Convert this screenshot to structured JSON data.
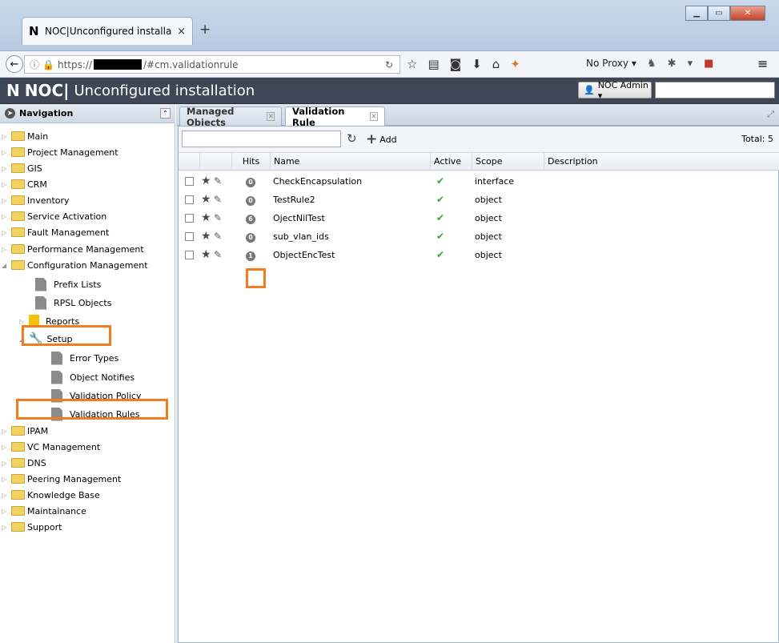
{
  "browser": {
    "tab_title": "NOC|Unconfigured installa...",
    "tab_close": "×",
    "new_tab": "+",
    "url_prefix": "https://",
    "url_suffix": "/#cm.validationrule",
    "proxy_label": "No Proxy ▾"
  },
  "app": {
    "brand_short": "NOC|",
    "title": "Unconfigured installation",
    "user": "NOC Admin ▾"
  },
  "sidebar": {
    "header": "Navigation",
    "items": [
      {
        "label": "Main",
        "type": "folder",
        "level": 0,
        "state": "collapsed"
      },
      {
        "label": "Project Management",
        "type": "folder",
        "level": 0,
        "state": "collapsed"
      },
      {
        "label": "GIS",
        "type": "folder",
        "level": 0,
        "state": "collapsed"
      },
      {
        "label": "CRM",
        "type": "folder",
        "level": 0,
        "state": "collapsed"
      },
      {
        "label": "Inventory",
        "type": "folder",
        "level": 0,
        "state": "collapsed"
      },
      {
        "label": "Service Activation",
        "type": "folder",
        "level": 0,
        "state": "collapsed"
      },
      {
        "label": "Fault Management",
        "type": "folder",
        "level": 0,
        "state": "collapsed"
      },
      {
        "label": "Performance Management",
        "type": "folder",
        "level": 0,
        "state": "collapsed"
      },
      {
        "label": "Configuration Management",
        "type": "folder",
        "level": 0,
        "state": "expanded"
      },
      {
        "label": "Prefix Lists",
        "type": "doc",
        "level": 1
      },
      {
        "label": "RPSL Objects",
        "type": "doc",
        "level": 1
      },
      {
        "label": "Reports",
        "type": "report",
        "level": 1,
        "state": "collapsed"
      },
      {
        "label": "Setup",
        "type": "wrench",
        "level": 1,
        "state": "expanded"
      },
      {
        "label": "Error Types",
        "type": "doc",
        "level": 2
      },
      {
        "label": "Object Notifies",
        "type": "doc",
        "level": 2
      },
      {
        "label": "Validation Policy",
        "type": "doc",
        "level": 2
      },
      {
        "label": "Validation Rules",
        "type": "doc",
        "level": 2
      },
      {
        "label": "IPAM",
        "type": "folder",
        "level": 0,
        "state": "collapsed"
      },
      {
        "label": "VC Management",
        "type": "folder",
        "level": 0,
        "state": "collapsed"
      },
      {
        "label": "DNS",
        "type": "folder",
        "level": 0,
        "state": "collapsed"
      },
      {
        "label": "Peering Management",
        "type": "folder",
        "level": 0,
        "state": "collapsed"
      },
      {
        "label": "Knowledge Base",
        "type": "folder",
        "level": 0,
        "state": "collapsed"
      },
      {
        "label": "Maintainance",
        "type": "folder",
        "level": 0,
        "state": "collapsed"
      },
      {
        "label": "Support",
        "type": "folder",
        "level": 0,
        "state": "collapsed"
      }
    ]
  },
  "tabs": [
    {
      "label": "Managed Objects",
      "active": false
    },
    {
      "label": "Validation Rule",
      "active": true
    }
  ],
  "toolbar": {
    "add_label": "Add",
    "total": "Total: 5"
  },
  "grid": {
    "columns": [
      "Hits",
      "Name",
      "Active",
      "Scope",
      "Description"
    ],
    "rows": [
      {
        "hits": "0",
        "name": "CheckEncapsulation",
        "active": "✔",
        "scope": "interface",
        "description": ""
      },
      {
        "hits": "0",
        "name": "TestRule2",
        "active": "✔",
        "scope": "object",
        "description": ""
      },
      {
        "hits": "6",
        "name": "OjectNilTest",
        "active": "✔",
        "scope": "object",
        "description": ""
      },
      {
        "hits": "0",
        "name": "sub_vlan_ids",
        "active": "✔",
        "scope": "object",
        "description": ""
      },
      {
        "hits": "1",
        "name": "ObjectEncTest",
        "active": "✔",
        "scope": "object",
        "description": ""
      }
    ]
  },
  "colors": {
    "highlight": "#f17c21",
    "header_bg": "#3f4756",
    "active_tick": "#3aa63a"
  }
}
